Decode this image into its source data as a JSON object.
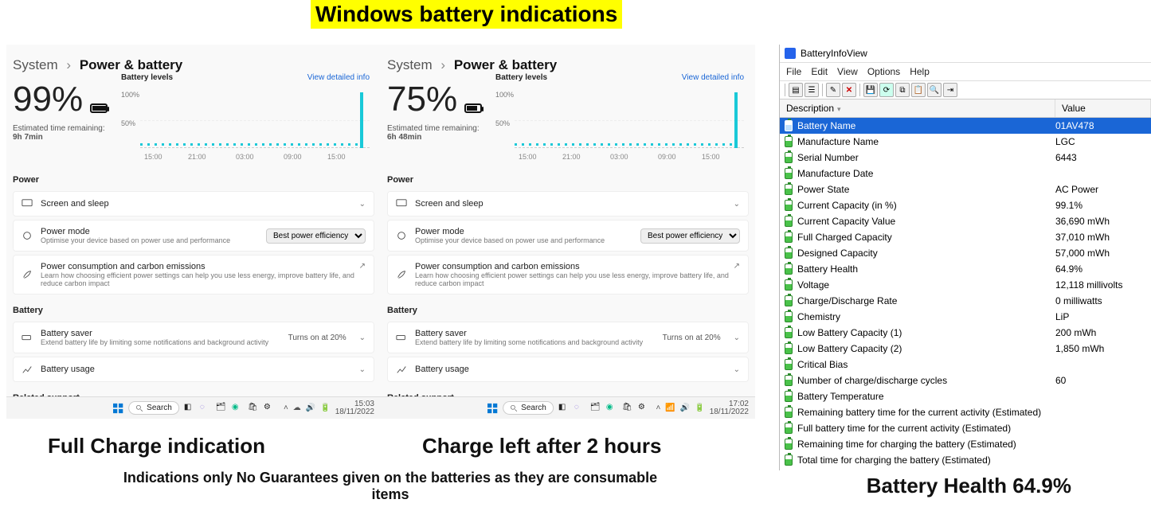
{
  "headline": "Windows battery indications",
  "captions": {
    "left": "Full Charge indication",
    "center": "Charge left after 2 hours",
    "right": "Battery Health 64.9%",
    "disclaimer": "Indications only No Guarantees given on the batteries as they are consumable items"
  },
  "settings_common": {
    "breadcrumb_parent": "System",
    "breadcrumb_child": "Power & battery",
    "battery_levels_label": "Battery levels",
    "view_detailed": "View detailed info",
    "y100": "100%",
    "y50": "50%",
    "xticks": [
      "15:00",
      "21:00",
      "03:00",
      "09:00",
      "15:00"
    ],
    "power_section": "Power",
    "screen_sleep": "Screen and sleep",
    "power_mode_title": "Power mode",
    "power_mode_sub": "Optimise your device based on power use and performance",
    "power_mode_value": "Best power efficiency",
    "pce_title": "Power consumption and carbon emissions",
    "pce_sub": "Learn how choosing efficient power settings can help you use less energy, improve battery life, and reduce carbon impact",
    "battery_section": "Battery",
    "saver_title": "Battery saver",
    "saver_sub": "Extend battery life by limiting some notifications and background activity",
    "saver_tag": "Turns on at 20%",
    "usage_title": "Battery usage",
    "related_support": "Related support",
    "taskbar_search": "Search"
  },
  "panel_left": {
    "percent": "99%",
    "est_label": "Estimated time remaining:",
    "est_value": "9h 7min",
    "fill_pct": 99,
    "tray_time": "15:03",
    "tray_date": "18/11/2022"
  },
  "panel_center": {
    "percent": "75%",
    "est_label": "Estimated time remaining:",
    "est_value": "6h 48min",
    "fill_pct": 75,
    "tray_time": "17:02",
    "tray_date": "18/11/2022"
  },
  "biv": {
    "title": "BatteryInfoView",
    "menus": [
      "File",
      "Edit",
      "View",
      "Options",
      "Help"
    ],
    "col_desc": "Description",
    "col_val": "Value",
    "rows": [
      {
        "desc": "Battery Name",
        "val": "01AV478",
        "sel": true
      },
      {
        "desc": "Manufacture Name",
        "val": "LGC"
      },
      {
        "desc": "Serial Number",
        "val": "6443"
      },
      {
        "desc": "Manufacture Date",
        "val": ""
      },
      {
        "desc": "Power State",
        "val": "AC Power"
      },
      {
        "desc": "Current Capacity (in %)",
        "val": "99.1%"
      },
      {
        "desc": "Current Capacity Value",
        "val": "36,690 mWh"
      },
      {
        "desc": "Full Charged Capacity",
        "val": "37,010 mWh"
      },
      {
        "desc": "Designed Capacity",
        "val": "57,000 mWh"
      },
      {
        "desc": "Battery Health",
        "val": "64.9%"
      },
      {
        "desc": "Voltage",
        "val": "12,118 millivolts"
      },
      {
        "desc": "Charge/Discharge Rate",
        "val": "0 milliwatts"
      },
      {
        "desc": "Chemistry",
        "val": "LiP"
      },
      {
        "desc": "Low Battery Capacity (1)",
        "val": "200 mWh"
      },
      {
        "desc": "Low Battery Capacity (2)",
        "val": "1,850 mWh"
      },
      {
        "desc": "Critical Bias",
        "val": ""
      },
      {
        "desc": "Number of charge/discharge cycles",
        "val": "60"
      },
      {
        "desc": "Battery Temperature",
        "val": ""
      },
      {
        "desc": "Remaining battery time for the current activity (Estimated)",
        "val": ""
      },
      {
        "desc": "Full battery time for the current activity (Estimated)",
        "val": ""
      },
      {
        "desc": "Remaining time for charging the battery (Estimated)",
        "val": ""
      },
      {
        "desc": "Total  time for charging the battery (Estimated)",
        "val": ""
      }
    ]
  }
}
